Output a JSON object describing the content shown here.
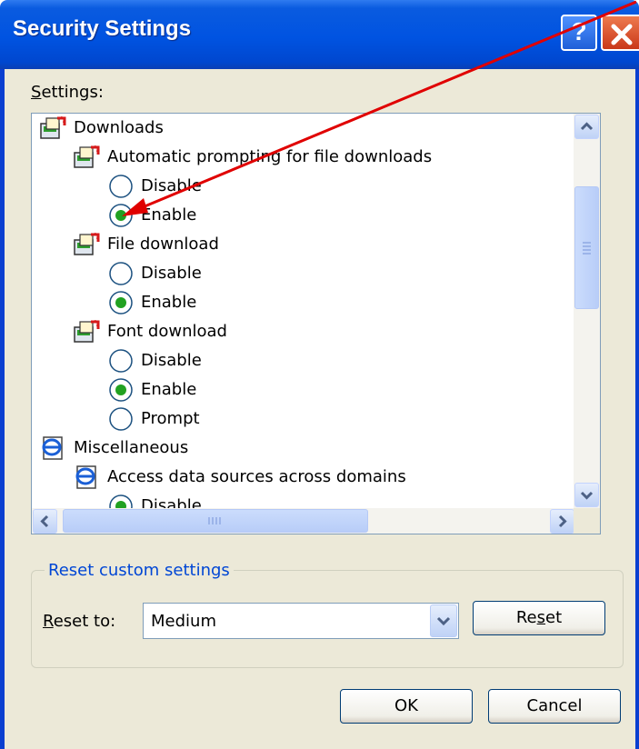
{
  "window": {
    "title": "Security Settings",
    "help_label": "?",
    "close_label": "✕"
  },
  "settings_label": "Settings:",
  "tree": [
    {
      "kind": "group",
      "icon": "settings-group-icon",
      "label": "Downloads",
      "indent": 0
    },
    {
      "kind": "group",
      "icon": "settings-group-icon",
      "label": "Automatic prompting for file downloads",
      "indent": 1
    },
    {
      "kind": "radio",
      "label": "Disable",
      "checked": false,
      "indent": 2
    },
    {
      "kind": "radio",
      "label": "Enable",
      "checked": true,
      "indent": 2
    },
    {
      "kind": "group",
      "icon": "settings-group-icon",
      "label": "File download",
      "indent": 1
    },
    {
      "kind": "radio",
      "label": "Disable",
      "checked": false,
      "indent": 2
    },
    {
      "kind": "radio",
      "label": "Enable",
      "checked": true,
      "indent": 2
    },
    {
      "kind": "group",
      "icon": "settings-group-icon",
      "label": "Font download",
      "indent": 1
    },
    {
      "kind": "radio",
      "label": "Disable",
      "checked": false,
      "indent": 2
    },
    {
      "kind": "radio",
      "label": "Enable",
      "checked": true,
      "indent": 2
    },
    {
      "kind": "radio",
      "label": "Prompt",
      "checked": false,
      "indent": 2
    },
    {
      "kind": "group",
      "icon": "ie-page-icon",
      "label": "Miscellaneous",
      "indent": 0
    },
    {
      "kind": "group",
      "icon": "ie-page-icon",
      "label": "Access data sources across domains",
      "indent": 1
    },
    {
      "kind": "radio",
      "label": "Disable",
      "checked": true,
      "indent": 2
    }
  ],
  "reset_group": {
    "title": "Reset custom settings",
    "reset_to_label": "Reset to:",
    "reset_to_value": "Medium",
    "reset_button": "Reset"
  },
  "buttons": {
    "ok": "OK",
    "cancel": "Cancel"
  },
  "colors": {
    "titlebar": "#0053e1",
    "radio_selected": "#21a121",
    "annotation_arrow": "#e00000",
    "group_title": "#0046d5"
  }
}
